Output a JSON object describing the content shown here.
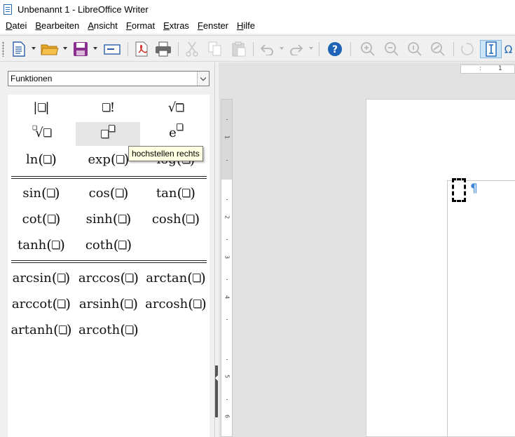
{
  "window": {
    "title": "Unbenannt 1 - LibreOffice Writer"
  },
  "menu": [
    "Datei",
    "Bearbeiten",
    "Ansicht",
    "Format",
    "Extras",
    "Fenster",
    "Hilfe"
  ],
  "sidebar": {
    "category": "Funktionen",
    "tooltip": "hochstellen rechts",
    "basic": {
      "exp_prefix": "e",
      "ln": "ln",
      "exp": "exp",
      "log": "log",
      "fact": "!",
      "sqrt": "√",
      "nroot": "√"
    },
    "trig": [
      "sin",
      "cos",
      "tan",
      "cot",
      "sinh",
      "cosh",
      "tanh",
      "coth"
    ],
    "arc": [
      "arcsin",
      "arccos",
      "arctan",
      "arccot",
      "arsinh",
      "arcosh",
      "artanh",
      "arcoth"
    ]
  },
  "ruler": {
    "h_label": "1",
    "v_labels": [
      "1",
      "2",
      "3",
      "4",
      "5",
      "6"
    ]
  },
  "document": {
    "pilcrow": "¶"
  },
  "colors": {
    "pilcrow": "#3b86d6",
    "help": "#1e63b5",
    "highlight": "#e5e5e5"
  }
}
